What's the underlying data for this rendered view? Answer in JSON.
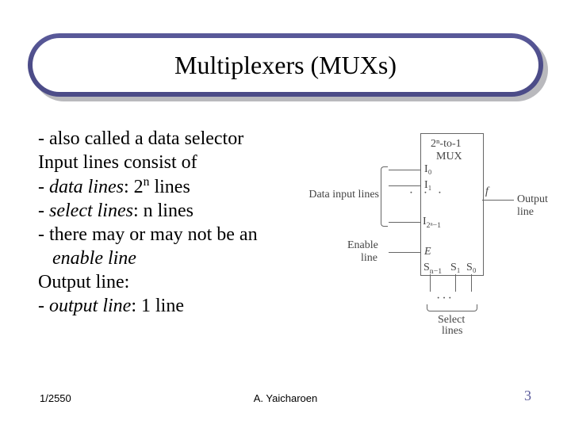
{
  "title": "Multiplexers (MUXs)",
  "bullets": {
    "l1": "- also called a data selector",
    "l2": "Input lines consist of",
    "l3a": "- ",
    "l3b": "data lines",
    "l3c_prefix": ": 2",
    "l3c_sup": "n",
    "l3c_suffix": " lines",
    "l4a": "- ",
    "l4b": "select lines",
    "l4c": ": n lines",
    "l5": "- there may or may not be an",
    "l6": "enable line",
    "l7": "Output line:",
    "l8a": "- ",
    "l8b": "output line",
    "l8c": ": 1 line"
  },
  "diagram": {
    "box_top": "2ⁿ-to-1",
    "box_bottom": "MUX",
    "data_inputs": "Data input lines",
    "enable_top": "Enable",
    "enable_bottom": "line",
    "select": "Select",
    "select2": "lines",
    "output": "Output line",
    "I0": "I₀",
    "I1": "I₁",
    "Ilast_pre": "I",
    "Ilast_sub": "2ⁿ−1",
    "E": "E",
    "f": "f",
    "S0": "S₀",
    "S1": "S₁",
    "Sn_pre": "S",
    "Sn_sub": "n−1",
    "hellip": "···"
  },
  "footer": {
    "left": "1/2550",
    "center": "A. Yaicharoen",
    "right": "3"
  }
}
